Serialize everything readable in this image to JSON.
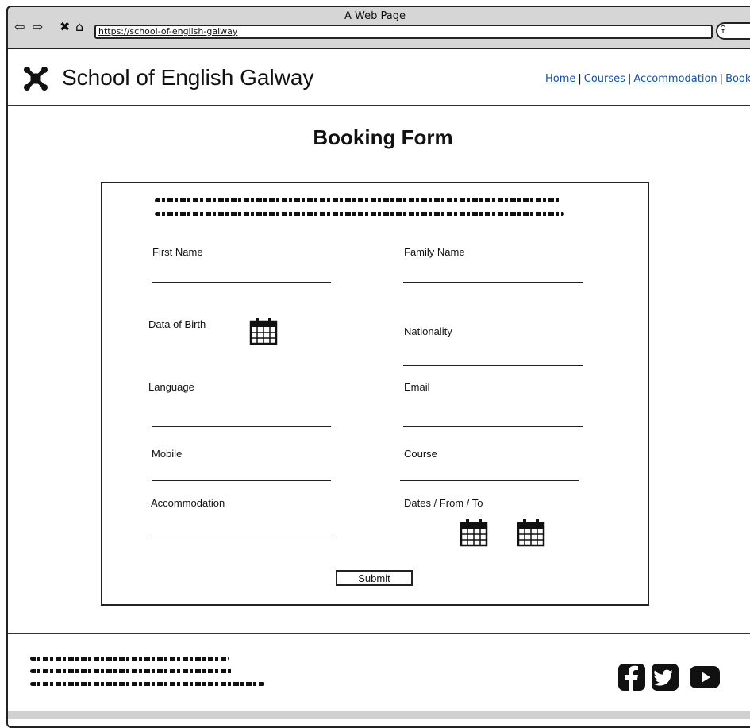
{
  "browser": {
    "window_title": "A Web Page",
    "url": "https://school-of-english-galway"
  },
  "header": {
    "site_title": "School of English Galway",
    "nav": [
      "Home",
      "Courses",
      "Accommodation",
      "Book"
    ]
  },
  "page": {
    "title": "Booking Form"
  },
  "form": {
    "fields": {
      "first_name": "First Name",
      "family_name": "Family Name",
      "dob": "Data of Birth",
      "nationality": "Nationality",
      "language": "Language",
      "email": "Email",
      "mobile": "Mobile",
      "course": "Course",
      "accommodation": "Accommodation",
      "dates": "Dates / From / To"
    },
    "submit_label": "Submit"
  },
  "footer": {
    "social": [
      "facebook-icon",
      "twitter-icon",
      "youtube-icon"
    ]
  }
}
